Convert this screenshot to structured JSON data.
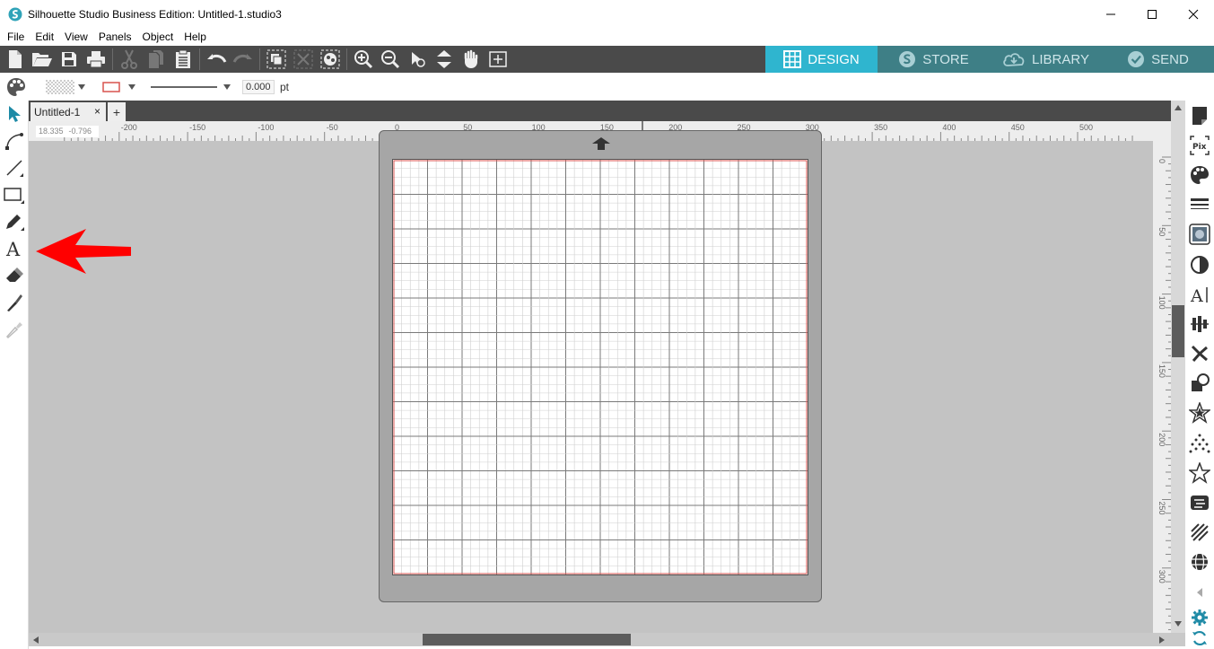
{
  "window": {
    "title": "Silhouette Studio Business Edition: Untitled-1.studio3"
  },
  "menu": {
    "items": [
      "File",
      "Edit",
      "View",
      "Panels",
      "Object",
      "Help"
    ]
  },
  "mode_tabs": [
    {
      "label": "DESIGN",
      "icon": "grid-icon",
      "active": true
    },
    {
      "label": "STORE",
      "icon": "silhouette-s-icon",
      "active": false
    },
    {
      "label": "LIBRARY",
      "icon": "cloud-download-icon",
      "active": false
    },
    {
      "label": "SEND",
      "icon": "checkmark-icon",
      "active": false
    }
  ],
  "style_bar": {
    "line_width": "0.000",
    "unit": "pt"
  },
  "document": {
    "tab_label": "Untitled-1",
    "close_glyph": "×",
    "add_glyph": "+"
  },
  "ruler": {
    "coords_x": "18.335",
    "coords_y": "-0.796",
    "h_labels": [
      "-200",
      "-150",
      "-100",
      "-50",
      "0",
      "50",
      "100",
      "150",
      "200",
      "250",
      "300",
      "350",
      "400",
      "450",
      "500"
    ],
    "v_labels": [
      "0",
      "50",
      "100",
      "150",
      "200",
      "250",
      "300"
    ]
  },
  "colors": {
    "toolbar_bg": "#4a4a4a",
    "design_tab": "#2fb5cf",
    "other_tab": "#3e7f86",
    "canvas_bg": "#c3c3c3",
    "mat_bg": "#a6a6a6",
    "cut_border": "#d9534f",
    "annotation_arrow": "#ff0000"
  },
  "annotation": {
    "target": "text-tool",
    "icon": "red-arrow-icon"
  }
}
